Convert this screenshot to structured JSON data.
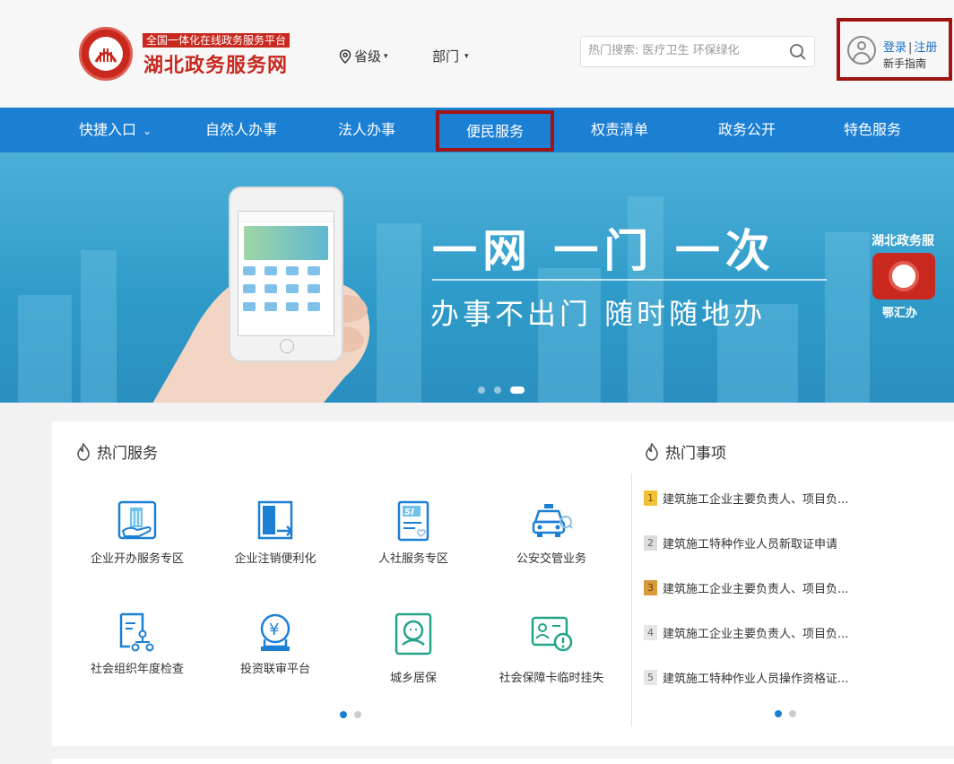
{
  "header": {
    "slogan": "全国一体化在线政务服务平台",
    "site_name": "湖北政务服务网",
    "region_label": "省级",
    "dept_label": "部门",
    "search_placeholder": "热门搜索: 医疗卫生 环保绿化",
    "login_label": "登录",
    "separator": "|",
    "register_label": "注册",
    "guide_label": "新手指南"
  },
  "nav": {
    "items": [
      {
        "label": "快捷入口"
      },
      {
        "label": "自然人办事"
      },
      {
        "label": "法人办事"
      },
      {
        "label": "便民服务"
      },
      {
        "label": "权责清单"
      },
      {
        "label": "政务公开"
      },
      {
        "label": "特色服务"
      }
    ],
    "active_index": 3
  },
  "banner": {
    "headline": "一网 一门 一次",
    "subline": "办事不出门 随时随地办",
    "app_name": "湖北政务服",
    "app_label": "鄂汇办",
    "slide_count": 3,
    "active_slide": 3
  },
  "hot_services": {
    "title": "热门服务",
    "items": [
      {
        "label": "企业开办服务专区",
        "icon": "building-hand-icon"
      },
      {
        "label": "企业注销便利化",
        "icon": "exit-door-icon"
      },
      {
        "label": "人社服务专区",
        "icon": "si-document-icon"
      },
      {
        "label": "公安交管业务",
        "icon": "police-car-icon"
      },
      {
        "label": "社会组织年度检查",
        "icon": "org-chart-icon"
      },
      {
        "label": "投资联审平台",
        "icon": "yen-coin-icon"
      },
      {
        "label": "城乡居保",
        "icon": "face-card-icon"
      },
      {
        "label": "社会保障卡临时挂失",
        "icon": "id-card-alert-icon"
      }
    ],
    "page_count": 2,
    "active_page": 1
  },
  "hot_matters": {
    "title": "热门事项",
    "items": [
      {
        "rank": "1",
        "text": "建筑施工企业主要负责人、项目负..."
      },
      {
        "rank": "2",
        "text": "建筑施工特种作业人员新取证申请"
      },
      {
        "rank": "3",
        "text": "建筑施工企业主要负责人、项目负..."
      },
      {
        "rank": "4",
        "text": "建筑施工企业主要负责人、项目负..."
      },
      {
        "rank": "5",
        "text": "建筑施工特种作业人员操作资格证..."
      }
    ],
    "page_count": 2,
    "active_page": 1
  },
  "colors": {
    "brand_red": "#c8281e",
    "nav_blue": "#1b7fd4",
    "highlight_border": "#a11414",
    "link_blue": "#1a6fc8"
  }
}
